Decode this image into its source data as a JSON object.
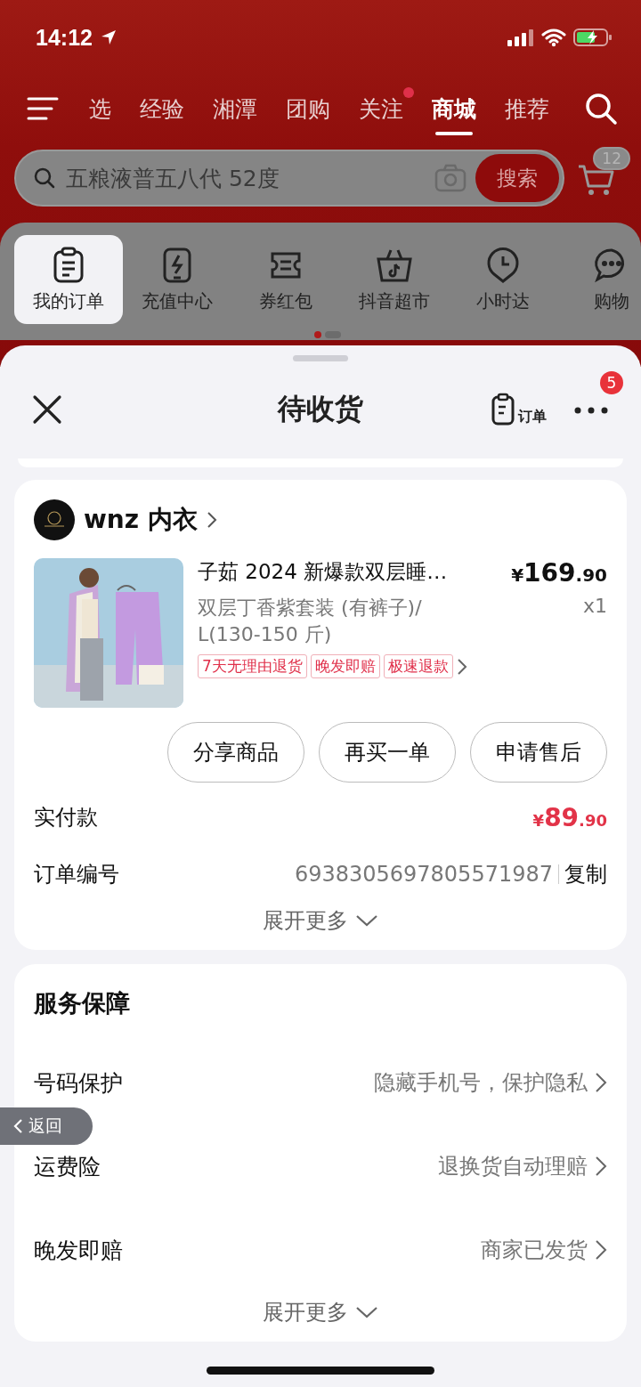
{
  "status_bar": {
    "time": "14:12"
  },
  "top_tabs": [
    {
      "label": "选",
      "selected": false,
      "dot": false
    },
    {
      "label": "经验",
      "selected": false,
      "dot": false
    },
    {
      "label": "湘潭",
      "selected": false,
      "dot": false
    },
    {
      "label": "团购",
      "selected": false,
      "dot": false
    },
    {
      "label": "关注",
      "selected": false,
      "dot": true
    },
    {
      "label": "商城",
      "selected": true,
      "dot": false
    },
    {
      "label": "推荐",
      "selected": false,
      "dot": false
    }
  ],
  "search": {
    "placeholder": "五粮液普五八代 52度",
    "button": "搜索",
    "cart_badge": "12"
  },
  "shortcuts": [
    {
      "label": "我的订单",
      "kind": "clipboard",
      "selected": true
    },
    {
      "label": "充值中心",
      "kind": "phone",
      "selected": false
    },
    {
      "label": "券红包",
      "kind": "ticket",
      "selected": false
    },
    {
      "label": "抖音超市",
      "kind": "basket",
      "selected": false
    },
    {
      "label": "小时达",
      "kind": "clock",
      "selected": false
    },
    {
      "label": "购物",
      "kind": "chat",
      "selected": false
    }
  ],
  "pages": [
    {
      "selected": true
    },
    {
      "selected": false
    }
  ],
  "sheet": {
    "title": "待收货",
    "order_label": "订单",
    "more_badge": "5"
  },
  "shop": {
    "name": "wnz 内衣"
  },
  "product": {
    "title": "子茹 2024 新爆款双层睡…",
    "spec": "双层丁香紫套装 (有裤子)/ L(130-150 斤)",
    "price": {
      "symbol": "¥",
      "integer": "169",
      "decimal": ".90"
    },
    "quantity": "x1",
    "tags": [
      "7天无理由退货",
      "晚发即赔",
      "极速退款"
    ]
  },
  "actions": [
    "分享商品",
    "再买一单",
    "申请售后"
  ],
  "payment": {
    "label": "实付款",
    "price": {
      "symbol": "¥",
      "integer": "89",
      "decimal": ".90"
    }
  },
  "order_number": {
    "label": "订单编号",
    "value": "6938305697805571987",
    "copy": "复制"
  },
  "expand": "展开更多",
  "services": {
    "title": "服务保障",
    "rows": [
      {
        "label": "号码保护",
        "value": "隐藏手机号，保护隐私"
      },
      {
        "label": "运费险",
        "value": "退换货自动理赔"
      },
      {
        "label": "晚发即赔",
        "value": "商家已发货"
      }
    ],
    "expand": "展开更多"
  },
  "back_button": "返回"
}
